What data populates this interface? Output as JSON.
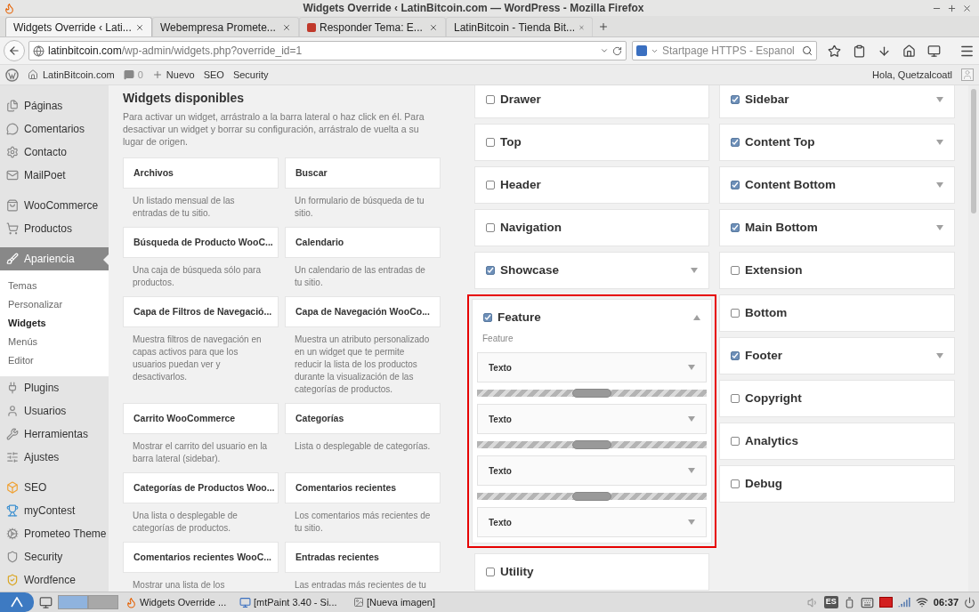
{
  "window": {
    "title": "Widgets Override ‹ LatinBitcoin.com — WordPress - Mozilla Firefox"
  },
  "tabs": [
    {
      "label": "Widgets Override ‹ Lati...",
      "selected": true
    },
    {
      "label": "Webempresa Promete...",
      "selected": false
    },
    {
      "label": "Responder Tema: E...",
      "selected": false
    },
    {
      "label": "LatinBitcoin - Tienda Bit...",
      "selected": false
    }
  ],
  "address_bar": {
    "host": "latinbitcoin.com",
    "path": "/wp-admin/widgets.php?override_id=1"
  },
  "search": {
    "placeholder": "Startpage HTTPS - Espanol"
  },
  "admin_bar": {
    "site": "LatinBitcoin.com",
    "comments": "0",
    "new": "Nuevo",
    "links": [
      "SEO",
      "Security"
    ],
    "greeting": "Hola, Quetzalcoatl"
  },
  "sidebar": {
    "groups": [
      [
        {
          "label": "Páginas",
          "selected": false
        },
        {
          "label": "Comentarios",
          "selected": false
        },
        {
          "label": "Contacto",
          "selected": false
        },
        {
          "label": "MailPoet",
          "selected": false
        }
      ],
      [
        {
          "label": "WooCommerce",
          "selected": false
        },
        {
          "label": "Productos",
          "selected": false
        }
      ],
      [
        {
          "label": "Apariencia",
          "selected": true,
          "children": [
            {
              "label": "Temas",
              "selected": false
            },
            {
              "label": "Personalizar",
              "selected": false
            },
            {
              "label": "Widgets",
              "selected": true
            },
            {
              "label": "Menús",
              "selected": false
            },
            {
              "label": "Editor",
              "selected": false
            }
          ]
        },
        {
          "label": "Plugins",
          "selected": false
        },
        {
          "label": "Usuarios",
          "selected": false
        },
        {
          "label": "Herramientas",
          "selected": false
        },
        {
          "label": "Ajustes",
          "selected": false
        }
      ],
      [
        {
          "label": "SEO",
          "selected": false
        },
        {
          "label": "myContest",
          "selected": false
        },
        {
          "label": "Prometeo Theme",
          "selected": false
        },
        {
          "label": "Security",
          "selected": false
        },
        {
          "label": "Wordfence",
          "selected": false
        }
      ]
    ]
  },
  "available_widgets": {
    "title": "Widgets disponibles",
    "intro": "Para activar un widget, arrástralo a la barra lateral o haz click en él. Para desactivar un widget y borrar su configuración, arrástralo de vuelta a su lugar de origen.",
    "items": [
      {
        "name": "Archivos",
        "description": "Un listado mensual de las entradas de tu sitio."
      },
      {
        "name": "Buscar",
        "description": "Un formulario de búsqueda de tu sitio."
      },
      {
        "name": "Búsqueda de Producto WooC...",
        "description": "Una caja de búsqueda sólo para productos."
      },
      {
        "name": "Calendario",
        "description": "Un calendario de las entradas de tu sitio."
      },
      {
        "name": "Capa de Filtros de Navegació...",
        "description": "Muestra filtros de navegación en capas activos para que los usuarios puedan ver y desactivarlos."
      },
      {
        "name": "Capa de Navegación WooCo...",
        "description": "Muestra un atributo personalizado en un widget que te permite reducir la lista de los productos durante la visualización de las categorías de productos."
      },
      {
        "name": "Carrito WooCommerce",
        "description": "Mostrar el carrito del usuario en la barra lateral (sidebar)."
      },
      {
        "name": "Categorías",
        "description": "Lista o desplegable de categorías."
      },
      {
        "name": "Categorías de Productos Woo...",
        "description": "Una lista o desplegable de categorías de productos."
      },
      {
        "name": "Comentarios recientes",
        "description": "Los comentarios más recientes de tu sitio."
      },
      {
        "name": "Comentarios recientes WooC...",
        "description": "Mostrar una lista de los"
      },
      {
        "name": "Entradas recientes",
        "description": "Las entradas más recientes de tu"
      }
    ]
  },
  "widget_areas_left": [
    {
      "name": "Drawer",
      "checked": false,
      "expanded": false
    },
    {
      "name": "Top",
      "checked": false,
      "expanded": false
    },
    {
      "name": "Header",
      "checked": false,
      "expanded": false
    },
    {
      "name": "Navigation",
      "checked": false,
      "expanded": false
    },
    {
      "name": "Showcase",
      "checked": true,
      "expanded": false
    },
    {
      "name": "Feature",
      "checked": true,
      "expanded": true,
      "highlighted": true,
      "description": "Feature",
      "widgets": [
        "Texto",
        "Texto",
        "Texto",
        "Texto"
      ]
    },
    {
      "name": "Utility",
      "checked": false,
      "expanded": false
    }
  ],
  "widget_areas_right": [
    {
      "name": "Sidebar",
      "checked": true,
      "expanded": false
    },
    {
      "name": "Content Top",
      "checked": true,
      "expanded": false
    },
    {
      "name": "Content Bottom",
      "checked": true,
      "expanded": false
    },
    {
      "name": "Main Bottom",
      "checked": true,
      "expanded": false
    },
    {
      "name": "Extension",
      "checked": false,
      "expanded": false
    },
    {
      "name": "Bottom",
      "checked": false,
      "expanded": false
    },
    {
      "name": "Footer",
      "checked": true,
      "expanded": false
    },
    {
      "name": "Copyright",
      "checked": false,
      "expanded": false
    },
    {
      "name": "Analytics",
      "checked": false,
      "expanded": false
    },
    {
      "name": "Debug",
      "checked": false,
      "expanded": false
    }
  ],
  "taskbar": {
    "workspaces": [
      {
        "selected": true
      },
      {
        "selected": false
      }
    ],
    "apps": [
      "Widgets Override ...",
      "[mtPaint 3.40 - Si...",
      "[Nueva imagen]"
    ],
    "keyboard_layout": "ES",
    "clock": "06:37"
  }
}
